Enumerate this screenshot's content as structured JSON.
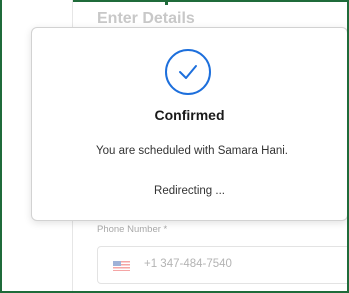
{
  "background_form": {
    "heading": "Enter Details",
    "phone_label": "Phone Number *",
    "phone_value": "+1 347-484-7540",
    "flag_icon": "us-flag-icon"
  },
  "modal": {
    "icon": "checkmark-circle-icon",
    "title": "Confirmed",
    "message": "You are scheduled with Samara Hani.",
    "status": "Redirecting ..."
  },
  "colors": {
    "accent": "#1d6fdc",
    "frame": "#1f6b3a"
  }
}
